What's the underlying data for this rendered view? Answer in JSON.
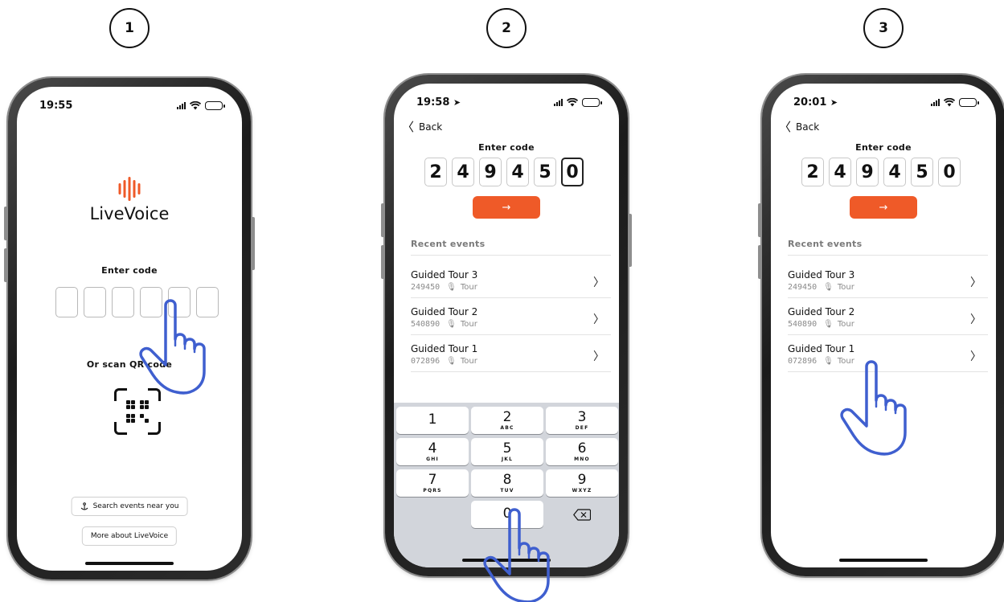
{
  "steps": [
    "1",
    "2",
    "3"
  ],
  "phone1": {
    "time": "19:55",
    "brand": "LiveVoice",
    "enter_code": "Enter code",
    "scan_qr": "Or scan QR code",
    "search_events": "Search events near you",
    "more_about": "More about LiveVoice",
    "icons": {
      "logo": "sound-bars-logo",
      "qr": "qr-code-icon",
      "search": "anchor-location-icon"
    }
  },
  "phone2": {
    "time": "19:58",
    "back": "Back",
    "enter_code": "Enter code",
    "digits": [
      "2",
      "4",
      "9",
      "4",
      "5",
      "0"
    ],
    "arrow": "→",
    "recent_title": "Recent events",
    "events": [
      {
        "name": "Guided Tour 3",
        "code": "249450",
        "type": "Tour"
      },
      {
        "name": "Guided Tour 2",
        "code": "540890",
        "type": "Tour"
      },
      {
        "name": "Guided Tour 1",
        "code": "072896",
        "type": "Tour"
      }
    ],
    "keypad": [
      {
        "num": "1",
        "letters": ""
      },
      {
        "num": "2",
        "letters": "ABC"
      },
      {
        "num": "3",
        "letters": "DEF"
      },
      {
        "num": "4",
        "letters": "GHI"
      },
      {
        "num": "5",
        "letters": "JKL"
      },
      {
        "num": "6",
        "letters": "MNO"
      },
      {
        "num": "7",
        "letters": "PQRS"
      },
      {
        "num": "8",
        "letters": "TUV"
      },
      {
        "num": "9",
        "letters": "WXYZ"
      },
      {
        "num": "0",
        "letters": ""
      }
    ]
  },
  "phone3": {
    "time": "20:01",
    "back": "Back",
    "enter_code": "Enter code",
    "digits": [
      "2",
      "4",
      "9",
      "4",
      "5",
      "0"
    ],
    "arrow": "→",
    "recent_title": "Recent events",
    "events": [
      {
        "name": "Guided Tour 3",
        "code": "249450",
        "type": "Tour"
      },
      {
        "name": "Guided Tour 2",
        "code": "540890",
        "type": "Tour"
      },
      {
        "name": "Guided Tour 1",
        "code": "072896",
        "type": "Tour"
      }
    ]
  },
  "colors": {
    "accent": "#ef5a28",
    "hand": "#3f5fcf",
    "keypad_bg": "#d2d5db"
  }
}
